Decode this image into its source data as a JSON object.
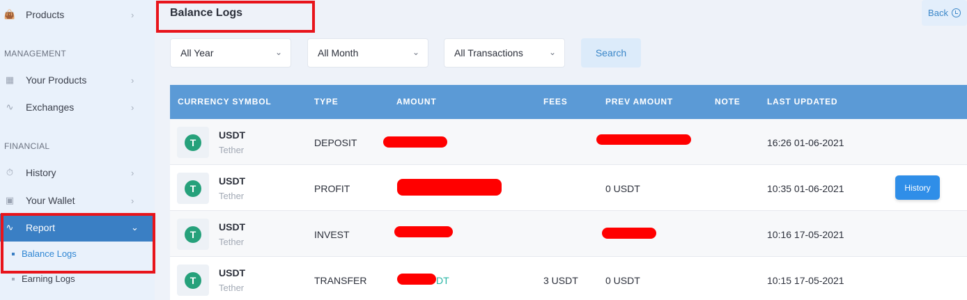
{
  "sidebar": {
    "items": [
      {
        "label": "Products",
        "icon": "bag-icon"
      },
      {
        "label": "Your Products",
        "icon": "box-icon"
      },
      {
        "label": "Exchanges",
        "icon": "chart-icon"
      },
      {
        "label": "History",
        "icon": "timer-icon"
      },
      {
        "label": "Your Wallet",
        "icon": "wallet-icon"
      },
      {
        "label": "Report",
        "icon": "report-icon"
      }
    ],
    "sections": {
      "management": "MANAGEMENT",
      "financial": "FINANCIAL"
    },
    "sub_items": [
      {
        "label": "Balance Logs"
      },
      {
        "label": "Earning Logs"
      }
    ]
  },
  "header": {
    "title": "Balance Logs",
    "back_label": "Back"
  },
  "filters": {
    "year": "All Year",
    "month": "All Month",
    "transactions": "All Transactions",
    "search_label": "Search"
  },
  "table": {
    "columns": [
      "CURRENCY SYMBOL",
      "TYPE",
      "AMOUNT",
      "FEES",
      "PREV AMOUNT",
      "NOTE",
      "LAST UPDATED"
    ],
    "rows": [
      {
        "symbol": "USDT",
        "name": "Tether",
        "type": "DEPOSIT",
        "amount": "",
        "fees": "",
        "prev_amount": "",
        "note": "",
        "updated": "16:26 01-06-2021",
        "action": ""
      },
      {
        "symbol": "USDT",
        "name": "Tether",
        "type": "PROFIT",
        "amount": "",
        "fees": "",
        "prev_amount": "0 USDT",
        "note": "",
        "updated": "10:35 01-06-2021",
        "action": "History"
      },
      {
        "symbol": "USDT",
        "name": "Tether",
        "type": "INVEST",
        "amount": "",
        "fees": "",
        "prev_amount": "",
        "note": "",
        "updated": "10:16 17-05-2021",
        "action": ""
      },
      {
        "symbol": "USDT",
        "name": "Tether",
        "type": "TRANSFER",
        "amount": "DT",
        "fees": "3 USDT",
        "prev_amount": "0 USDT",
        "note": "",
        "updated": "10:15 17-05-2021",
        "action": ""
      }
    ]
  },
  "colors": {
    "accent": "#3a7fc4",
    "table_header": "#5b9ad6",
    "annotation": "#e8141b",
    "tether": "#26a17b"
  }
}
